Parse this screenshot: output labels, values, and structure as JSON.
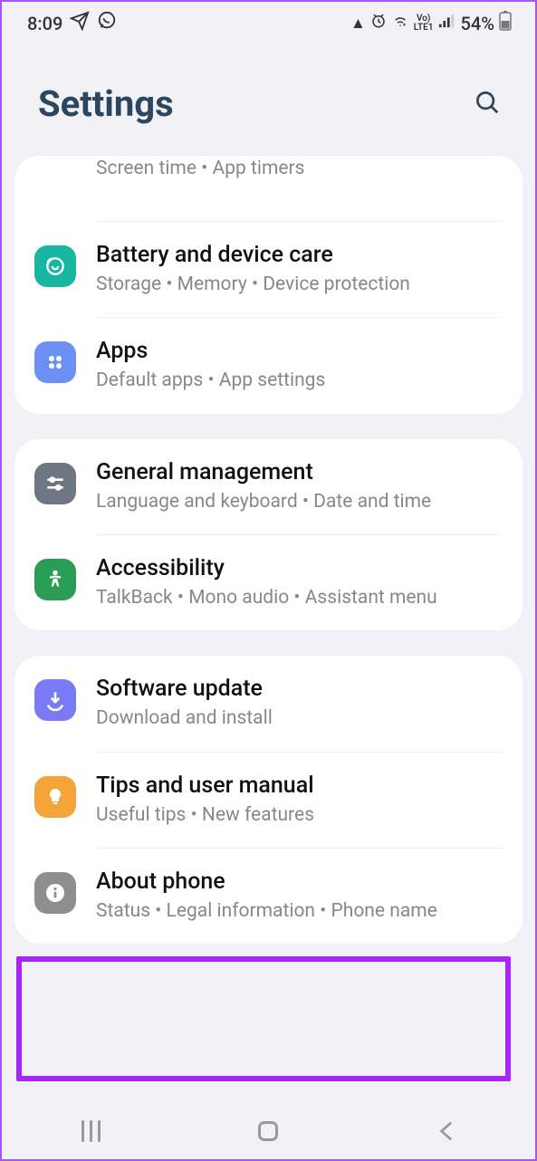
{
  "status": {
    "time": "8:09",
    "battery_pct": "54%",
    "lte": "LTE1",
    "vo": "Vo)"
  },
  "header": {
    "title": "Settings"
  },
  "groups": [
    {
      "items": [
        {
          "title": "",
          "sub": "Screen time  •  App timers",
          "icon": "placeholder",
          "partial": true
        },
        {
          "title": "Battery and device care",
          "sub": "Storage  •  Memory  •  Device protection",
          "icon": "device-care"
        },
        {
          "title": "Apps",
          "sub": "Default apps  •  App settings",
          "icon": "apps"
        }
      ]
    },
    {
      "items": [
        {
          "title": "General management",
          "sub": "Language and keyboard  •  Date and time",
          "icon": "general"
        },
        {
          "title": "Accessibility",
          "sub": "TalkBack  •  Mono audio  •  Assistant menu",
          "icon": "accessibility"
        }
      ]
    },
    {
      "items": [
        {
          "title": "Software update",
          "sub": "Download and install",
          "icon": "update"
        },
        {
          "title": "Tips and user manual",
          "sub": "Useful tips  •  New features",
          "icon": "tips"
        },
        {
          "title": "About phone",
          "sub": "Status  •  Legal information  •  Phone name",
          "icon": "about"
        }
      ]
    }
  ]
}
